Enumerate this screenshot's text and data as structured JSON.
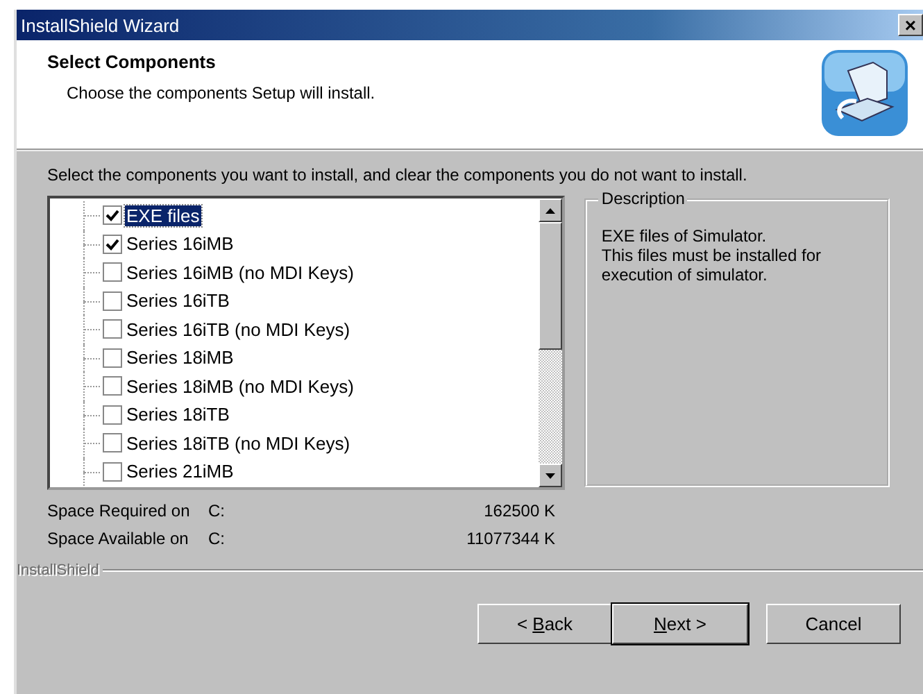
{
  "window": {
    "title": "InstallShield Wizard",
    "close": "×"
  },
  "header": {
    "title": "Select Components",
    "subtitle": "Choose the components Setup will install."
  },
  "instructions": "Select the components you want to install, and clear the components you do not want to install.",
  "components": [
    {
      "label": "EXE files",
      "checked": true,
      "selected": true
    },
    {
      "label": "Series 16iMB",
      "checked": true,
      "selected": false
    },
    {
      "label": "Series 16iMB (no MDI Keys)",
      "checked": false,
      "selected": false
    },
    {
      "label": "Series 16iTB",
      "checked": false,
      "selected": false
    },
    {
      "label": "Series 16iTB (no MDI Keys)",
      "checked": false,
      "selected": false
    },
    {
      "label": "Series 18iMB",
      "checked": false,
      "selected": false
    },
    {
      "label": "Series 18iMB (no MDI Keys)",
      "checked": false,
      "selected": false
    },
    {
      "label": "Series 18iTB",
      "checked": false,
      "selected": false
    },
    {
      "label": "Series 18iTB (no MDI Keys)",
      "checked": false,
      "selected": false
    },
    {
      "label": "Series 21iMB",
      "checked": false,
      "selected": false
    }
  ],
  "description": {
    "title": "Description",
    "text": "EXE files of Simulator.\nThis files must be installed for execution of simulator."
  },
  "space": [
    {
      "label": "Space Required on",
      "drive": "C:",
      "value": "162500 K"
    },
    {
      "label": "Space Available on",
      "drive": "C:",
      "value": "11077344 K"
    }
  ],
  "brand": "InstallShield",
  "buttons": [
    {
      "before": "< ",
      "key": "B",
      "after": "ack",
      "default": false
    },
    {
      "key": "N",
      "after": "ext >",
      "default": true
    },
    {
      "before": "Cancel",
      "default": false
    }
  ]
}
